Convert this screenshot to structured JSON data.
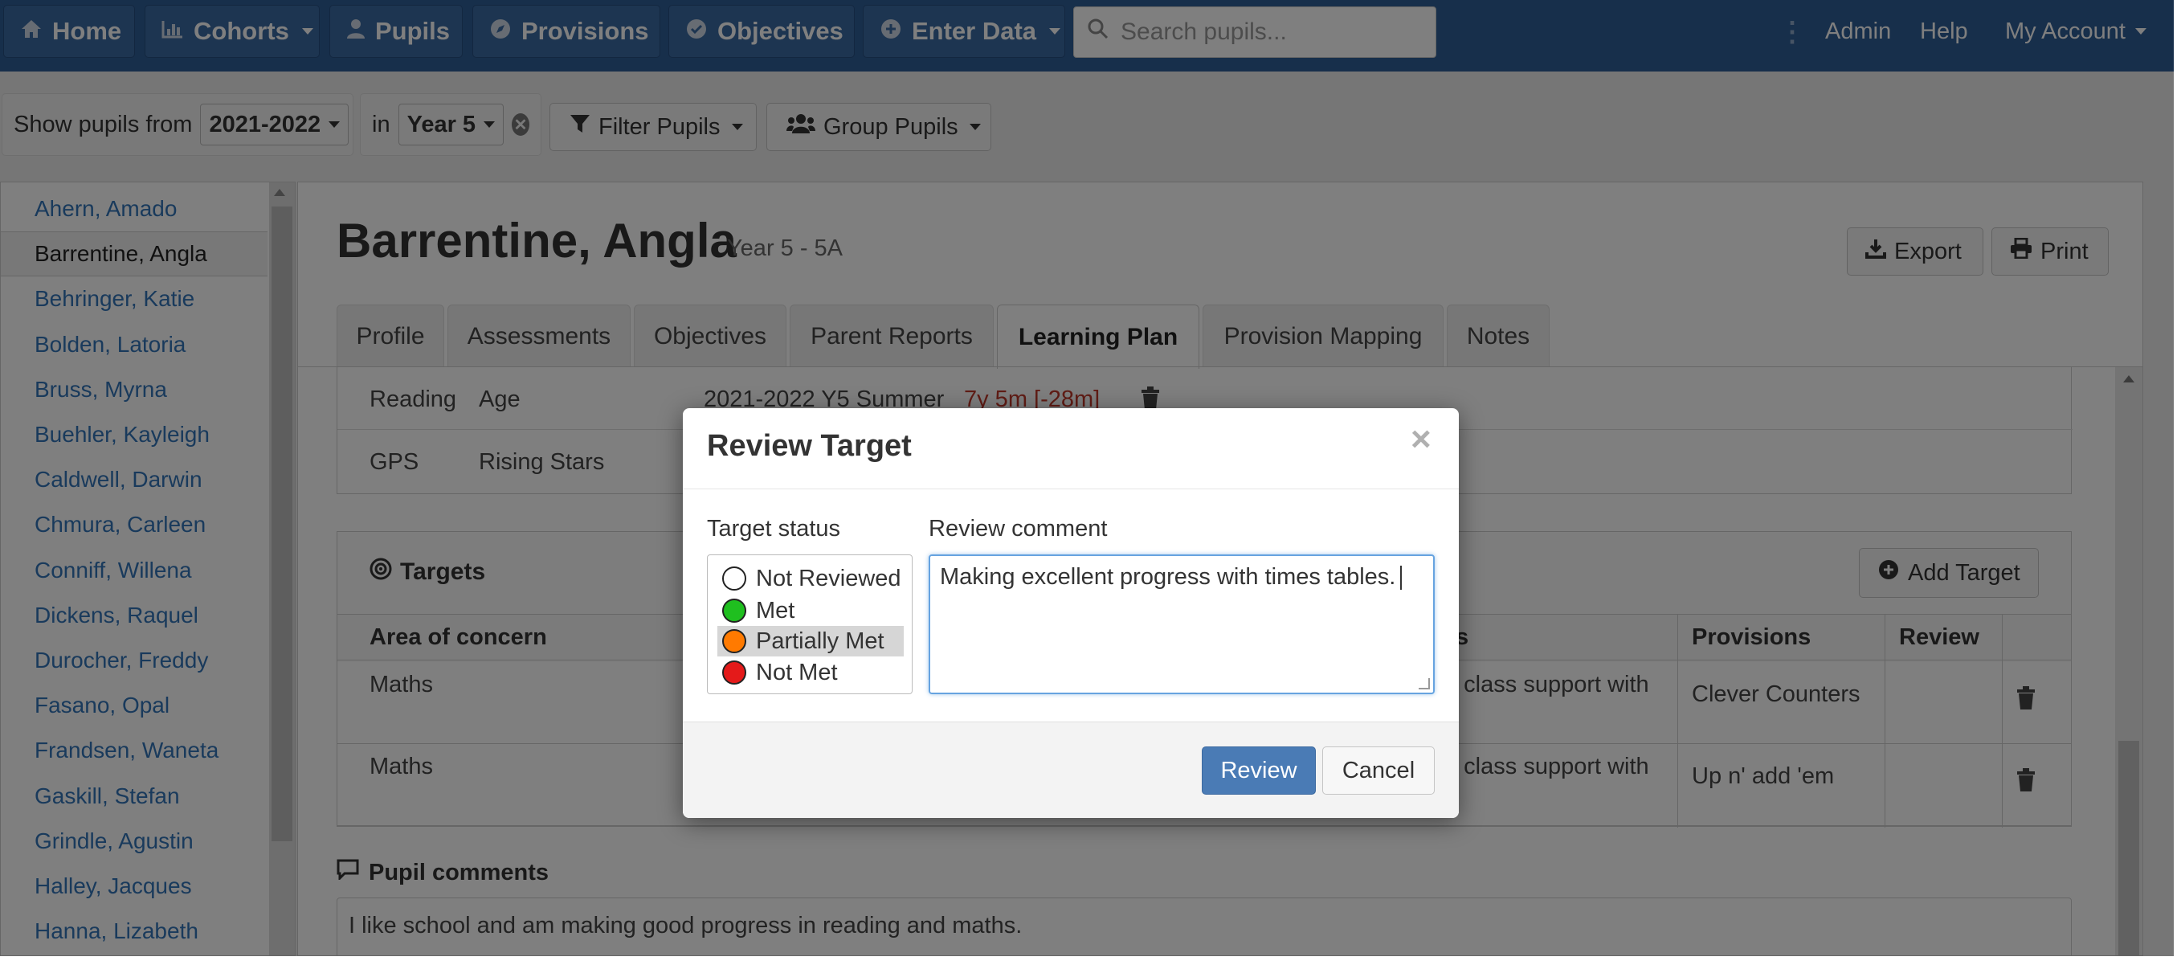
{
  "nav": {
    "home": "Home",
    "cohorts": "Cohorts",
    "pupils": "Pupils",
    "provisions": "Provisions",
    "objectives": "Objectives",
    "enter_data": "Enter Data",
    "search_placeholder": "Search pupils...",
    "admin": "Admin",
    "help": "Help",
    "my_account": "My Account"
  },
  "filters": {
    "show_from_label": "Show pupils from",
    "year_value": "2021-2022",
    "in_label": "in",
    "group_value": "Year 5",
    "filter_pupils": "Filter Pupils",
    "group_pupils": "Group Pupils"
  },
  "sidebar": {
    "pupils": [
      "Ahern, Amado",
      "Barrentine, Angla",
      "Behringer, Katie",
      "Bolden, Latoria",
      "Bruss, Myrna",
      "Buehler, Kayleigh",
      "Caldwell, Darwin",
      "Chmura, Carleen",
      "Conniff, Willena",
      "Dickens, Raquel",
      "Durocher, Freddy",
      "Fasano, Opal",
      "Frandsen, Waneta",
      "Gaskill, Stefan",
      "Grindle, Agustin",
      "Halley, Jacques",
      "Hanna, Lizabeth"
    ],
    "active_index": 1
  },
  "pupil": {
    "name": "Barrentine, Angla",
    "class": "Year 5 - 5A",
    "export": "Export",
    "print": "Print"
  },
  "tabs": [
    "Profile",
    "Assessments",
    "Objectives",
    "Parent Reports",
    "Learning Plan",
    "Provision Mapping",
    "Notes"
  ],
  "active_tab": "Learning Plan",
  "assessments": [
    {
      "subject": "Reading",
      "type": "Age",
      "period": "2021-2022 Y5 Summer",
      "value": "7y 5m [-28m]"
    },
    {
      "subject": "GPS",
      "type": "Rising Stars",
      "period": "",
      "value": ""
    }
  ],
  "targets": {
    "title": "Targets",
    "add_button": "Add Target",
    "columns": {
      "area": "Area of concern",
      "actions_partial": "s",
      "provisions": "Provisions",
      "review": "Review"
    },
    "rows": [
      {
        "area": "Maths",
        "action_partial": "n class support with",
        "provision": "Clever Counters"
      },
      {
        "area": "Maths",
        "action_partial": "n class support with",
        "provision": "Up n' add 'em"
      }
    ]
  },
  "pupil_comments": {
    "title": "Pupil comments",
    "text": "I like school and am making good progress in reading and maths."
  },
  "modal": {
    "title": "Review Target",
    "close": "×",
    "status_label": "Target status",
    "comment_label": "Review comment",
    "statuses": [
      {
        "label": "Not Reviewed",
        "color": "#ffffff"
      },
      {
        "label": "Met",
        "color": "#1fbf1f"
      },
      {
        "label": "Partially Met",
        "color": "#ff7a00"
      },
      {
        "label": "Not Met",
        "color": "#e41a1a"
      }
    ],
    "selected_status": "Partially Met",
    "comment_value": "Making excellent progress with times tables.",
    "review_button": "Review",
    "cancel_button": "Cancel"
  },
  "colors": {
    "navbar": "#2f5e96",
    "link": "#3375b8",
    "primary_button": "#4a7bb5",
    "assessment_value": "#c0392b"
  }
}
